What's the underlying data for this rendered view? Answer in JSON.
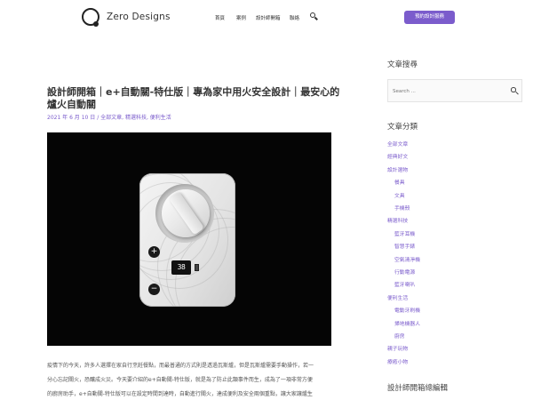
{
  "header": {
    "brand": "Zero Designs",
    "nav": [
      "首頁",
      "案例",
      "設計師開箱",
      "聯絡"
    ],
    "cta_label": "預約設計服務"
  },
  "article": {
    "title": "設計師開箱｜e+自動關-特仕版｜專為家中用火安全設計｜最安心的爐火自動關",
    "meta": {
      "date": "2021 年 6 月 10 日",
      "categories": "全部文章, 精選科技, 便利生活"
    },
    "hero_image": {
      "display_value": "38",
      "plus_symbol": "+",
      "minus_symbol": "−"
    },
    "body_lines": [
      "疫情下的今天，許多人選擇在家自行烹飪餐點，而最普通的方式則是透過瓦斯爐，但是瓦斯爐需要手動操作，若一",
      "分心忘記關火，恐釀成火災。今天要介紹的e+自動關-特仕版，就是為了防止此類事件而生，成為了一項非常方便",
      "的廚房助手，e+自動關-特仕版可以在設定時間到達時，自動進行關火，達成便利及安全兩個重點，讓大家讓爐生"
    ]
  },
  "sidebar": {
    "search_heading": "文章搜尋",
    "search_placeholder": "Search ...",
    "categories_heading": "文章分類",
    "categories": [
      {
        "label": "全部文章",
        "level": 0
      },
      {
        "label": "經典好文",
        "level": 0
      },
      {
        "label": "設計選物",
        "level": 0
      },
      {
        "label": "餐具",
        "level": 1
      },
      {
        "label": "文具",
        "level": 1
      },
      {
        "label": "手機殼",
        "level": 1
      },
      {
        "label": "精選科技",
        "level": 0
      },
      {
        "label": "藍牙耳機",
        "level": 1
      },
      {
        "label": "智慧手錶",
        "level": 1
      },
      {
        "label": "空氣清淨機",
        "level": 1
      },
      {
        "label": "行動電源",
        "level": 1
      },
      {
        "label": "藍牙喇叭",
        "level": 1
      },
      {
        "label": "便利生活",
        "level": 0
      },
      {
        "label": "電動牙刷機",
        "level": 1
      },
      {
        "label": "掃地機器人",
        "level": 1
      },
      {
        "label": "廚房",
        "level": 1
      },
      {
        "label": "親子玩物",
        "level": 0
      },
      {
        "label": "療癒小物",
        "level": 0
      }
    ],
    "magazine_heading": "設計師開箱總編輯"
  }
}
